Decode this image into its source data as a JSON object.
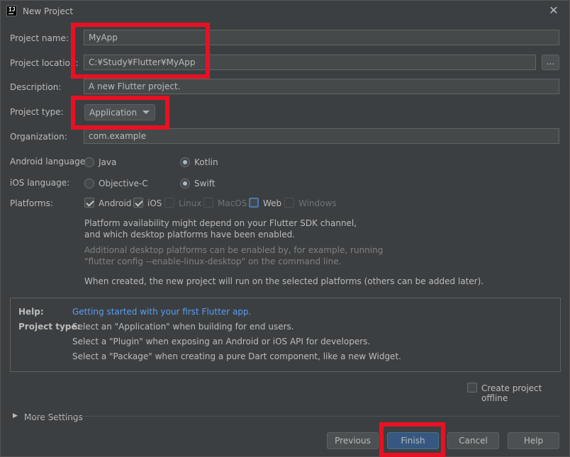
{
  "window": {
    "title": "New Project",
    "icon": "intellij-icon",
    "close_icon": "close-icon"
  },
  "form": {
    "project_name": {
      "label": "Project name:",
      "value": "MyApp"
    },
    "project_location": {
      "label": "Project location:",
      "value": "C:¥Study¥Flutter¥MyApp",
      "browse_label": "..."
    },
    "description": {
      "label": "Description:",
      "value": "A new Flutter project."
    },
    "project_type": {
      "label": "Project type:",
      "value": "Application"
    },
    "organization": {
      "label": "Organization:",
      "value": "com.example"
    },
    "android_language": {
      "label": "Android language:",
      "options": [
        "Java",
        "Kotlin"
      ],
      "selected": "Kotlin"
    },
    "ios_language": {
      "label": "iOS language:",
      "options": [
        "Objective-C",
        "Swift"
      ],
      "selected": "Swift"
    },
    "platforms": {
      "label": "Platforms:",
      "items": [
        {
          "label": "Android",
          "checked": true,
          "enabled": true
        },
        {
          "label": "iOS",
          "checked": true,
          "enabled": true
        },
        {
          "label": "Linux",
          "checked": false,
          "enabled": false
        },
        {
          "label": "MacOS",
          "checked": false,
          "enabled": false
        },
        {
          "label": "Web",
          "checked": false,
          "enabled": true,
          "focused": true
        },
        {
          "label": "Windows",
          "checked": false,
          "enabled": false
        }
      ]
    },
    "notes": {
      "line1": "Platform availability might depend on your Flutter SDK channel,",
      "line2": "and which desktop platforms have been enabled.",
      "line3": "Additional desktop platforms can be enabled by, for example, running",
      "line4": "\"flutter config --enable-linux-desktop\" on the command line.",
      "line5": "When created, the new project will run on the selected platforms (others can be added later)."
    }
  },
  "help": {
    "help_key": "Help:",
    "help_link": "Getting started with your first Flutter app.",
    "type_key": "Project type:",
    "type_lines": [
      "Select an \"Application\" when building for end users.",
      "Select a \"Plugin\" when exposing an Android or iOS API for developers.",
      "Select a \"Package\" when creating a pure Dart component, like a new Widget."
    ]
  },
  "offline": {
    "label": "Create project offline",
    "checked": false
  },
  "more_settings": {
    "label": "More Settings"
  },
  "buttons": {
    "previous": "Previous",
    "finish": "Finish",
    "cancel": "Cancel",
    "help": "Help"
  },
  "colors": {
    "background": "#3c3f41",
    "link": "#589df6",
    "primary_button": "#365880",
    "highlight": "#e81123"
  }
}
